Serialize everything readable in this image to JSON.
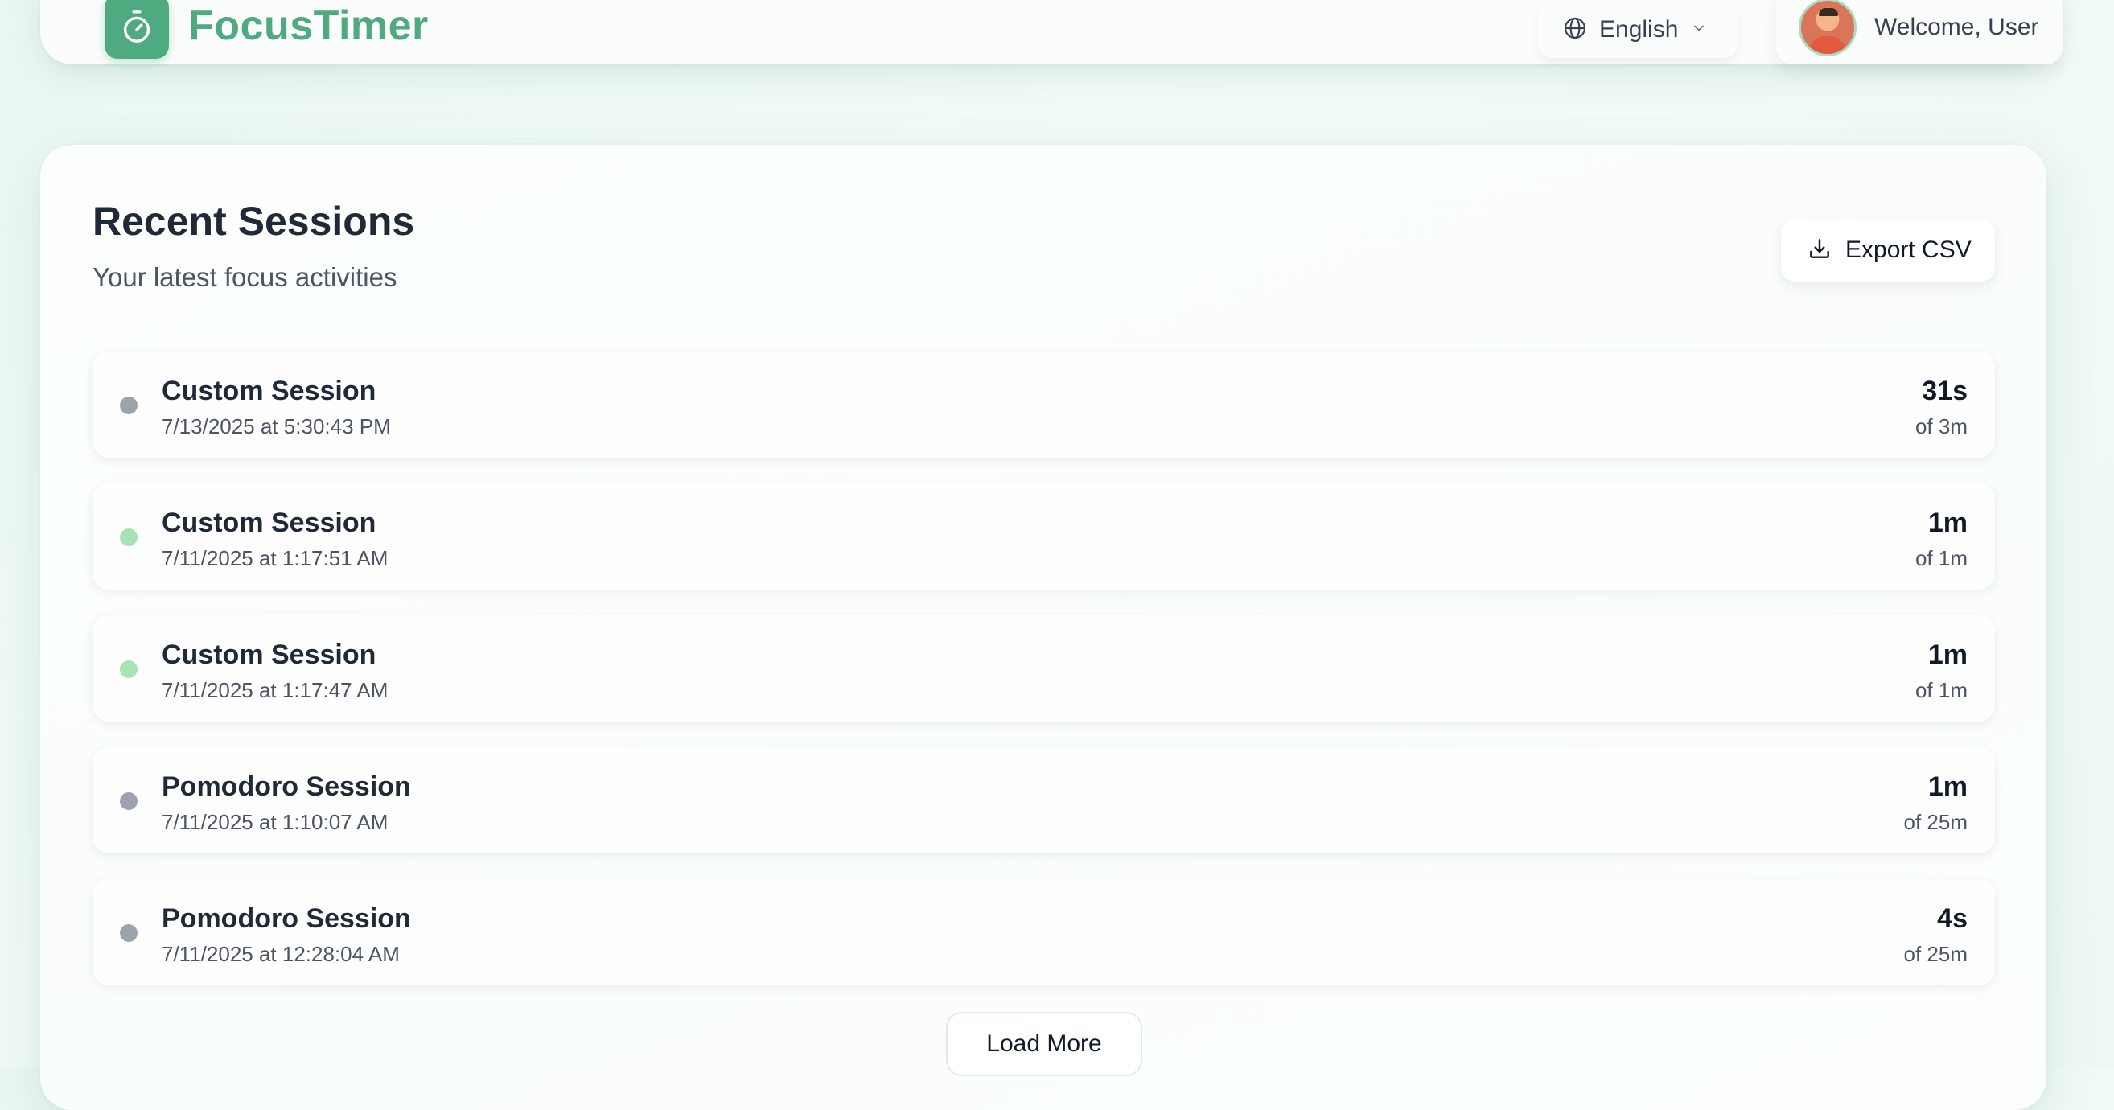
{
  "header": {
    "brand": "FocusTimer",
    "logo_icon": "stopwatch-icon",
    "language": "English",
    "welcome": "Welcome, User"
  },
  "main": {
    "title": "Recent Sessions",
    "subtitle": "Your latest focus activities",
    "export_label": "Export CSV",
    "load_more_label": "Load More",
    "sessions": [
      {
        "title": "Custom Session",
        "date": "7/13/2025 at 5:30:43 PM",
        "duration": "31s",
        "of": "of 3m",
        "status_color": "#9ca3af"
      },
      {
        "title": "Custom Session",
        "date": "7/11/2025 at 1:17:51 AM",
        "duration": "1m",
        "of": "of 1m",
        "status_color": "#a7e3b3"
      },
      {
        "title": "Custom Session",
        "date": "7/11/2025 at 1:17:47 AM",
        "duration": "1m",
        "of": "of 1m",
        "status_color": "#a7e3b3"
      },
      {
        "title": "Pomodoro Session",
        "date": "7/11/2025 at 1:10:07 AM",
        "duration": "1m",
        "of": "of 25m",
        "status_color": "#9ca3af"
      },
      {
        "title": "Pomodoro Session",
        "date": "7/11/2025 at 12:28:04 AM",
        "duration": "4s",
        "of": "of 25m",
        "status_color": "#9ca3af"
      }
    ]
  },
  "colors": {
    "brand": "#4faa80",
    "completed": "#a7e3b3",
    "incomplete": "#9ca3af"
  }
}
